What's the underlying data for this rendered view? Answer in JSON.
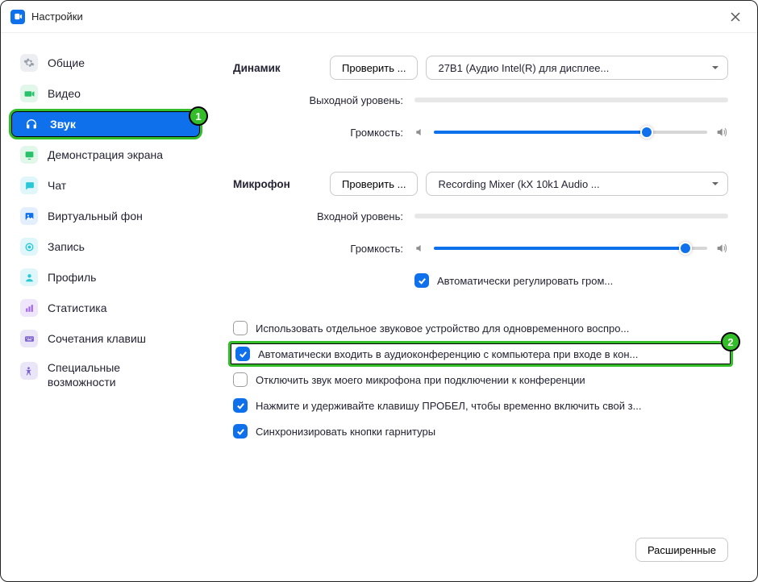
{
  "window": {
    "title": "Настройки"
  },
  "badges": {
    "one": "1",
    "two": "2"
  },
  "sidebar": {
    "items": [
      {
        "label": "Общие"
      },
      {
        "label": "Видео"
      },
      {
        "label": "Звук"
      },
      {
        "label": "Демонстрация экрана"
      },
      {
        "label": "Чат"
      },
      {
        "label": "Виртуальный фон"
      },
      {
        "label": "Запись"
      },
      {
        "label": "Профиль"
      },
      {
        "label": "Статистика"
      },
      {
        "label": "Сочетания клавиш"
      },
      {
        "label": "Специальные возможности"
      }
    ]
  },
  "main": {
    "speaker": {
      "label": "Динамик",
      "test_btn": "Проверить ...",
      "device": "27B1 (Аудио Intel(R) для дисплее...",
      "output_level": "Выходной уровень:",
      "volume": "Громкость:",
      "volume_pct": 78
    },
    "mic": {
      "label": "Микрофон",
      "test_btn": "Проверить ...",
      "device": "Recording Mixer (kX 10k1 Audio ...",
      "input_level": "Входной уровень:",
      "volume": "Громкость:",
      "volume_pct": 92,
      "auto_adjust": "Автоматически регулировать гром..."
    },
    "options": {
      "separate_device": "Использовать отдельное звуковое устройство для одновременного воспро...",
      "auto_join": "Автоматически входить в аудиоконференцию с компьютера при входе в кон...",
      "mute_on_join": "Отключить звук моего микрофона при подключении к конференции",
      "ptt_space": "Нажмите и удерживайте клавишу ПРОБЕЛ, чтобы временно включить свой з...",
      "sync_headset": "Синхронизировать кнопки гарнитуры"
    },
    "advanced_btn": "Расширенные"
  },
  "icons": {
    "colors": {
      "general": "#d9dbe0",
      "video": "#29c26a",
      "audio": "#0e71eb",
      "share": "#29c26a",
      "chat": "#29c8d6",
      "vbg": "#0e71eb",
      "record": "#29c8d6",
      "profile": "#29c8d6",
      "stats": "#a066e6",
      "keys": "#7b61d0",
      "access": "#7b61d0"
    }
  }
}
